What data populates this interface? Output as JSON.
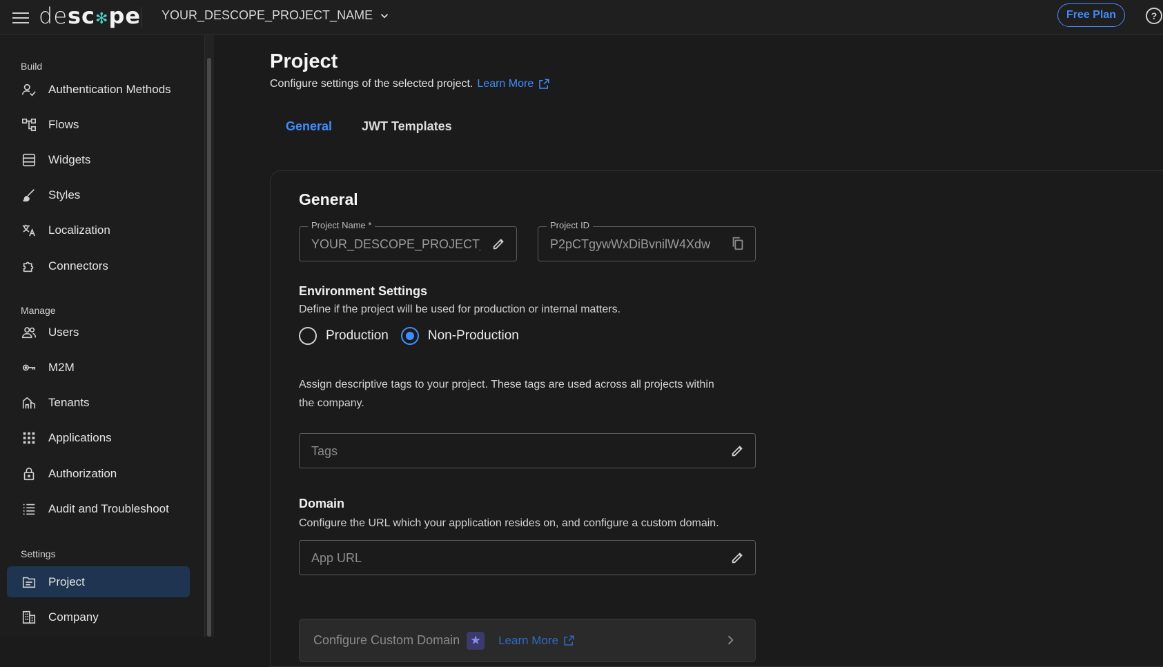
{
  "topbar": {
    "logo": {
      "part1": "de",
      "part2": "sc",
      "dot": "✻",
      "part3": "pe"
    },
    "project_name": "YOUR_DESCOPE_PROJECT_NAME",
    "plan_button": "Free Plan",
    "help_icon": "?"
  },
  "sidebar": {
    "sections": {
      "build": "Build",
      "manage": "Manage",
      "settings": "Settings"
    },
    "items": [
      {
        "label": "Authentication Methods",
        "icon": "user-check-icon"
      },
      {
        "label": "Flows",
        "icon": "flow-icon"
      },
      {
        "label": "Widgets",
        "icon": "widget-icon"
      },
      {
        "label": "Styles",
        "icon": "brush-icon"
      },
      {
        "label": "Localization",
        "icon": "translate-icon"
      },
      {
        "label": "Connectors",
        "icon": "puzzle-icon"
      },
      {
        "label": "Users",
        "icon": "users-icon"
      },
      {
        "label": "M2M",
        "icon": "key-icon"
      },
      {
        "label": "Tenants",
        "icon": "tenants-icon"
      },
      {
        "label": "Applications",
        "icon": "apps-grid-icon"
      },
      {
        "label": "Authorization",
        "icon": "lock-icon"
      },
      {
        "label": "Audit and Troubleshoot",
        "icon": "list-icon"
      },
      {
        "label": "Project",
        "icon": "folder-icon",
        "active": true
      },
      {
        "label": "Company",
        "icon": "building-icon"
      }
    ]
  },
  "main": {
    "title": "Project",
    "subtitle": "Configure settings of the selected project.",
    "learn_more": "Learn More",
    "tabs": [
      {
        "label": "General",
        "active": true
      },
      {
        "label": "JWT Templates",
        "active": false
      }
    ],
    "card": {
      "title": "General",
      "project_name_label": "Project Name *",
      "project_name_value": "YOUR_DESCOPE_PROJECT_NAME",
      "project_id_label": "Project ID",
      "project_id_value": "P2pCTgywWxDiBvnilW4Xdw",
      "env_title": "Environment Settings",
      "env_desc": "Define if the project will be used for production or internal matters.",
      "env_options": [
        {
          "label": "Production",
          "selected": false
        },
        {
          "label": "Non-Production",
          "selected": true
        }
      ],
      "tags_desc_1": "Assign descriptive tags to your project. These tags are used across all projects within",
      "tags_desc_2": "the company.",
      "tags_placeholder": "Tags",
      "domain_title": "Domain",
      "domain_desc": "Configure the URL which your application resides on, and configure a custom domain.",
      "app_url_placeholder": "App URL",
      "custom_domain": "Configure Custom Domain",
      "custom_domain_learn_more": "Learn More"
    }
  },
  "colors": {
    "accent": "#3f8dfd",
    "active_nav_bg": "#1e3450"
  }
}
